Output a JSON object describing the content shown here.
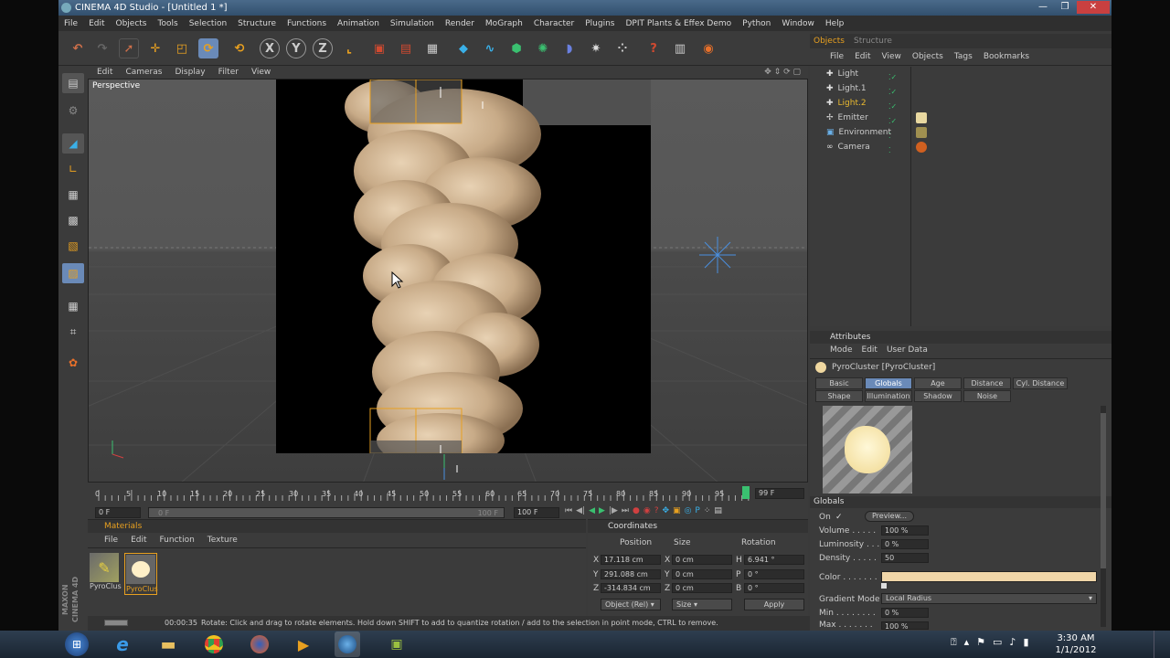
{
  "window": {
    "title": "CINEMA 4D Studio - [Untitled 1 *]",
    "minimize": "—",
    "maximize": "❐",
    "close": "✕"
  },
  "menu": [
    "File",
    "Edit",
    "Objects",
    "Tools",
    "Selection",
    "Structure",
    "Functions",
    "Animation",
    "Simulation",
    "Render",
    "MoGraph",
    "Character",
    "Plugins",
    "DPIT Plants & Effex Demo",
    "Python",
    "Window",
    "Help"
  ],
  "viewport": {
    "menu": [
      "Edit",
      "Cameras",
      "Display",
      "Filter",
      "View"
    ],
    "label": "Perspective"
  },
  "timeline": {
    "ticks": [
      "0",
      "5",
      "10",
      "15",
      "20",
      "25",
      "30",
      "35",
      "40",
      "45",
      "50",
      "55",
      "60",
      "65",
      "70",
      "75",
      "80",
      "85",
      "90",
      "95"
    ],
    "end_frame": "99 F",
    "start_field": "0 F",
    "min_field": "0 F",
    "max_field": "100 F",
    "end_field": "100 F"
  },
  "materials": {
    "title": "Materials",
    "menu": [
      "File",
      "Edit",
      "Function",
      "Texture"
    ],
    "items": [
      {
        "name": "PyroClus"
      },
      {
        "name": "PyroClus"
      }
    ]
  },
  "coordinates": {
    "title": "Coordinates",
    "headers": [
      "Position",
      "Size",
      "Rotation"
    ],
    "rows": [
      {
        "axis": "X",
        "pos": "17.118 cm",
        "size_axis": "X",
        "size": "0 cm",
        "rot_axis": "H",
        "rot": "6.941 °"
      },
      {
        "axis": "Y",
        "pos": "291.088 cm",
        "size_axis": "Y",
        "size": "0 cm",
        "rot_axis": "P",
        "rot": "0 °"
      },
      {
        "axis": "Z",
        "pos": "-314.834 cm",
        "size_axis": "Z",
        "size": "0 cm",
        "rot_axis": "B",
        "rot": "0 °"
      }
    ],
    "mode": "Object (Rel)",
    "size_mode": "Size",
    "apply": "Apply"
  },
  "objects": {
    "tabs": [
      "Objects",
      "Structure"
    ],
    "menu": [
      "File",
      "Edit",
      "View",
      "Objects",
      "Tags",
      "Bookmarks"
    ],
    "items": [
      {
        "name": "Light",
        "color": "#cccccc"
      },
      {
        "name": "Light.1",
        "color": "#cccccc"
      },
      {
        "name": "Light.2",
        "color": "#e8b830"
      },
      {
        "name": "Emitter",
        "color": "#cccccc"
      },
      {
        "name": "Environment",
        "color": "#cccccc"
      },
      {
        "name": "Camera",
        "color": "#cccccc"
      }
    ]
  },
  "attributes": {
    "title": "Attributes",
    "menu": [
      "Mode",
      "Edit",
      "User Data"
    ],
    "object_name": "PyroCluster [PyroCluster]",
    "tabs_row1": [
      "Basic",
      "Globals",
      "Age",
      "Distance",
      "Cyl. Distance"
    ],
    "tabs_row2": [
      "Shape",
      "Illumination",
      "Shadow",
      "Noise"
    ],
    "active_tab": "Globals",
    "section": "Globals",
    "on_label": "On",
    "on_check": "✓",
    "preview": "Preview...",
    "volume_label": "Volume . . . . .",
    "volume": "100 %",
    "luminosity_label": "Luminosity . . .",
    "luminosity": "0 %",
    "density_label": "Density . . . . .",
    "density": "50",
    "color_label": "Color . . . . . . .",
    "color": "#f0d6a8",
    "gradient_label": "Gradient Mode",
    "gradient_mode": "Local Radius",
    "min_label": "Min . . . . . . . .",
    "min": "0 %",
    "max_label": "Max . . . . . . .",
    "max": "100 %"
  },
  "status": {
    "time": "00:00:35",
    "message": "Rotate: Click and drag to rotate elements. Hold down SHIFT to add to quantize rotation / add to the selection in point mode, CTRL to remove."
  },
  "taskbar": {
    "time": "3:30 AM",
    "date": "1/1/2012"
  }
}
